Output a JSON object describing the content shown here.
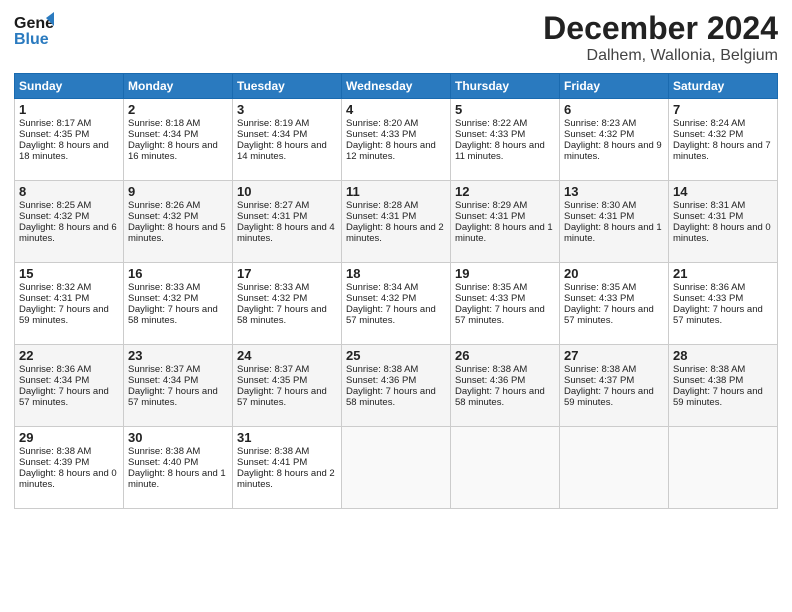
{
  "header": {
    "logo_line1": "General",
    "logo_line2": "Blue",
    "month": "December 2024",
    "location": "Dalhem, Wallonia, Belgium"
  },
  "days_of_week": [
    "Sunday",
    "Monday",
    "Tuesday",
    "Wednesday",
    "Thursday",
    "Friday",
    "Saturday"
  ],
  "weeks": [
    [
      {
        "day": "1",
        "info": "Sunrise: 8:17 AM\nSunset: 4:35 PM\nDaylight: 8 hours and 18 minutes."
      },
      {
        "day": "2",
        "info": "Sunrise: 8:18 AM\nSunset: 4:34 PM\nDaylight: 8 hours and 16 minutes."
      },
      {
        "day": "3",
        "info": "Sunrise: 8:19 AM\nSunset: 4:34 PM\nDaylight: 8 hours and 14 minutes."
      },
      {
        "day": "4",
        "info": "Sunrise: 8:20 AM\nSunset: 4:33 PM\nDaylight: 8 hours and 12 minutes."
      },
      {
        "day": "5",
        "info": "Sunrise: 8:22 AM\nSunset: 4:33 PM\nDaylight: 8 hours and 11 minutes."
      },
      {
        "day": "6",
        "info": "Sunrise: 8:23 AM\nSunset: 4:32 PM\nDaylight: 8 hours and 9 minutes."
      },
      {
        "day": "7",
        "info": "Sunrise: 8:24 AM\nSunset: 4:32 PM\nDaylight: 8 hours and 7 minutes."
      }
    ],
    [
      {
        "day": "8",
        "info": "Sunrise: 8:25 AM\nSunset: 4:32 PM\nDaylight: 8 hours and 6 minutes."
      },
      {
        "day": "9",
        "info": "Sunrise: 8:26 AM\nSunset: 4:32 PM\nDaylight: 8 hours and 5 minutes."
      },
      {
        "day": "10",
        "info": "Sunrise: 8:27 AM\nSunset: 4:31 PM\nDaylight: 8 hours and 4 minutes."
      },
      {
        "day": "11",
        "info": "Sunrise: 8:28 AM\nSunset: 4:31 PM\nDaylight: 8 hours and 2 minutes."
      },
      {
        "day": "12",
        "info": "Sunrise: 8:29 AM\nSunset: 4:31 PM\nDaylight: 8 hours and 1 minute."
      },
      {
        "day": "13",
        "info": "Sunrise: 8:30 AM\nSunset: 4:31 PM\nDaylight: 8 hours and 1 minute."
      },
      {
        "day": "14",
        "info": "Sunrise: 8:31 AM\nSunset: 4:31 PM\nDaylight: 8 hours and 0 minutes."
      }
    ],
    [
      {
        "day": "15",
        "info": "Sunrise: 8:32 AM\nSunset: 4:31 PM\nDaylight: 7 hours and 59 minutes."
      },
      {
        "day": "16",
        "info": "Sunrise: 8:33 AM\nSunset: 4:32 PM\nDaylight: 7 hours and 58 minutes."
      },
      {
        "day": "17",
        "info": "Sunrise: 8:33 AM\nSunset: 4:32 PM\nDaylight: 7 hours and 58 minutes."
      },
      {
        "day": "18",
        "info": "Sunrise: 8:34 AM\nSunset: 4:32 PM\nDaylight: 7 hours and 57 minutes."
      },
      {
        "day": "19",
        "info": "Sunrise: 8:35 AM\nSunset: 4:33 PM\nDaylight: 7 hours and 57 minutes."
      },
      {
        "day": "20",
        "info": "Sunrise: 8:35 AM\nSunset: 4:33 PM\nDaylight: 7 hours and 57 minutes."
      },
      {
        "day": "21",
        "info": "Sunrise: 8:36 AM\nSunset: 4:33 PM\nDaylight: 7 hours and 57 minutes."
      }
    ],
    [
      {
        "day": "22",
        "info": "Sunrise: 8:36 AM\nSunset: 4:34 PM\nDaylight: 7 hours and 57 minutes."
      },
      {
        "day": "23",
        "info": "Sunrise: 8:37 AM\nSunset: 4:34 PM\nDaylight: 7 hours and 57 minutes."
      },
      {
        "day": "24",
        "info": "Sunrise: 8:37 AM\nSunset: 4:35 PM\nDaylight: 7 hours and 57 minutes."
      },
      {
        "day": "25",
        "info": "Sunrise: 8:38 AM\nSunset: 4:36 PM\nDaylight: 7 hours and 58 minutes."
      },
      {
        "day": "26",
        "info": "Sunrise: 8:38 AM\nSunset: 4:36 PM\nDaylight: 7 hours and 58 minutes."
      },
      {
        "day": "27",
        "info": "Sunrise: 8:38 AM\nSunset: 4:37 PM\nDaylight: 7 hours and 59 minutes."
      },
      {
        "day": "28",
        "info": "Sunrise: 8:38 AM\nSunset: 4:38 PM\nDaylight: 7 hours and 59 minutes."
      }
    ],
    [
      {
        "day": "29",
        "info": "Sunrise: 8:38 AM\nSunset: 4:39 PM\nDaylight: 8 hours and 0 minutes."
      },
      {
        "day": "30",
        "info": "Sunrise: 8:38 AM\nSunset: 4:40 PM\nDaylight: 8 hours and 1 minute."
      },
      {
        "day": "31",
        "info": "Sunrise: 8:38 AM\nSunset: 4:41 PM\nDaylight: 8 hours and 2 minutes."
      },
      {
        "day": "",
        "info": ""
      },
      {
        "day": "",
        "info": ""
      },
      {
        "day": "",
        "info": ""
      },
      {
        "day": "",
        "info": ""
      }
    ]
  ]
}
